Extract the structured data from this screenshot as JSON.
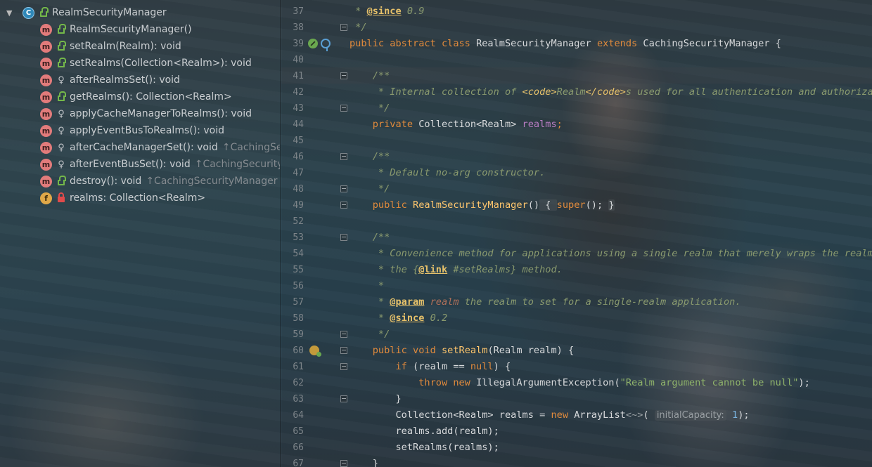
{
  "structure": {
    "root": {
      "label": "RealmSecurityManager",
      "kind_glyph": "C"
    },
    "items": [
      {
        "kind": "m",
        "vis": "public",
        "label": "RealmSecurityManager()",
        "inherit": ""
      },
      {
        "kind": "m",
        "vis": "public",
        "label": "setRealm(Realm): void",
        "inherit": ""
      },
      {
        "kind": "m",
        "vis": "public",
        "label": "setRealms(Collection<Realm>): void",
        "inherit": ""
      },
      {
        "kind": "m",
        "vis": "protected",
        "label": "afterRealmsSet(): void",
        "inherit": ""
      },
      {
        "kind": "m",
        "vis": "public",
        "label": "getRealms(): Collection<Realm>",
        "inherit": ""
      },
      {
        "kind": "m",
        "vis": "protected",
        "label": "applyCacheManagerToRealms(): void",
        "inherit": ""
      },
      {
        "kind": "m",
        "vis": "protected",
        "label": "applyEventBusToRealms(): void",
        "inherit": ""
      },
      {
        "kind": "m",
        "vis": "protected",
        "label": "afterCacheManagerSet(): void",
        "inherit": "↑CachingSecu"
      },
      {
        "kind": "m",
        "vis": "protected",
        "label": "afterEventBusSet(): void",
        "inherit": "↑CachingSecurityMa"
      },
      {
        "kind": "m",
        "vis": "public",
        "label": "destroy(): void",
        "inherit": "↑CachingSecurityManager"
      },
      {
        "kind": "f",
        "vis": "private",
        "label": "realms: Collection<Realm>",
        "inherit": ""
      }
    ]
  },
  "editor": {
    "line_numbers": [
      "37",
      "38",
      "39",
      "40",
      "41",
      "42",
      "43",
      "44",
      "45",
      "46",
      "47",
      "48",
      "49",
      "52",
      "53",
      "54",
      "55",
      "56",
      "57",
      "58",
      "59",
      "60",
      "61",
      "62",
      "63",
      "64",
      "65",
      "66",
      "67"
    ],
    "code": {
      "l37_a": " * ",
      "l37_tag": "@since",
      "l37_b": " 0.9",
      "l38": " */",
      "l39_kw1": "public abstract class ",
      "l39_name": "RealmSecurityManager ",
      "l39_kw2": "extends ",
      "l39_sup": "CachingSecurityManager {",
      "l41": "    /**",
      "l42_a": "     * Internal collection of ",
      "l42_code_open": "<code>",
      "l42_realm": "Realm",
      "l42_code_close": "</code>",
      "l42_b": "s used for all authentication and authorizati",
      "l43": "     */",
      "l44_kw": "    private ",
      "l44_type": "Collection<Realm> ",
      "l44_field": "realms",
      "l44_end": ";",
      "l46": "    /**",
      "l47": "     * Default no-arg constructor.",
      "l48": "     */",
      "l49_kw": "    public ",
      "l49_fn": "RealmSecurityManager",
      "l49_p": "()",
      "l49_b1": " { ",
      "l49_sup": "super",
      "l49_end": "(); ",
      "l49_b2": "}",
      "l53": "    /**",
      "l54": "     * Convenience method for applications using a single realm that merely wraps the realm i",
      "l55_a": "     * the {",
      "l55_tag": "@link",
      "l55_b": " #setRealms} method.",
      "l56": "     *",
      "l57_a": "     * ",
      "l57_tag": "@param",
      "l57_p": " realm",
      "l57_b": " the realm to set for a single-realm application.",
      "l58_a": "     * ",
      "l58_tag": "@since",
      "l58_b": " 0.2",
      "l59": "     */",
      "l60_kw": "    public void ",
      "l60_fn": "setRealm",
      "l60_b": "(Realm realm) {",
      "l61_kw": "        if ",
      "l61_a": "(realm == ",
      "l61_null": "null",
      "l61_b": ") {",
      "l62_kw": "            throw new ",
      "l62_a": "IllegalArgumentException(",
      "l62_str": "\"Realm argument cannot be null\"",
      "l62_b": ");",
      "l63": "        }",
      "l64_a": "        Collection<Realm> realms = ",
      "l64_kw": "new ",
      "l64_b": "ArrayList",
      "l64_gen": "<~>",
      "l64_c": "( ",
      "l64_hint": "initialCapacity:",
      "l64_num": " 1",
      "l64_d": ");",
      "l65": "        realms.add(realm);",
      "l66": "        setRealms(realms);",
      "l67": "    }"
    }
  }
}
